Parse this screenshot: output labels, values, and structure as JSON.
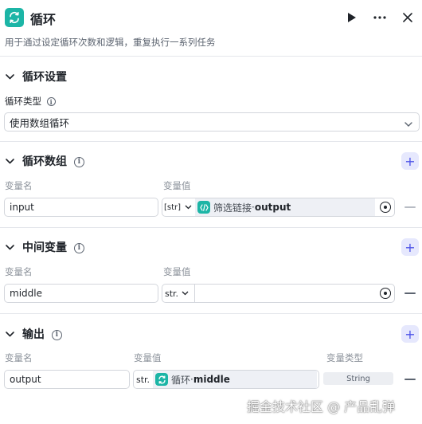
{
  "header": {
    "title": "循环",
    "description": "用于通过设定循环次数和逻辑，重复执行一系列任务"
  },
  "loop_settings": {
    "section_title": "循环设置",
    "type_label": "循环类型",
    "type_value": "使用数组循环"
  },
  "loop_array": {
    "section_title": "循环数组",
    "col_name": "变量名",
    "col_value": "变量值",
    "row": {
      "name": "input",
      "type_badge": "[str]",
      "ref_node": "筛选链接",
      "ref_sep": " · ",
      "ref_field": "output"
    }
  },
  "middle_vars": {
    "section_title": "中间变量",
    "col_name": "变量名",
    "col_value": "变量值",
    "row": {
      "name": "middle",
      "type_badge": "str."
    }
  },
  "output": {
    "section_title": "输出",
    "col_name": "变量名",
    "col_value": "变量值",
    "col_type": "变量类型",
    "row": {
      "name": "output",
      "type_badge": "str.",
      "ref_node": "循环",
      "ref_sep": " · ",
      "ref_field": "middle",
      "var_type": "String"
    }
  },
  "watermark": "掘金技术社区 @ 产品乱弹",
  "colors": {
    "node_teal": "#1cb5a6",
    "add_button_bg": "#e6e8fd",
    "add_button_fg": "#4d53e8"
  }
}
